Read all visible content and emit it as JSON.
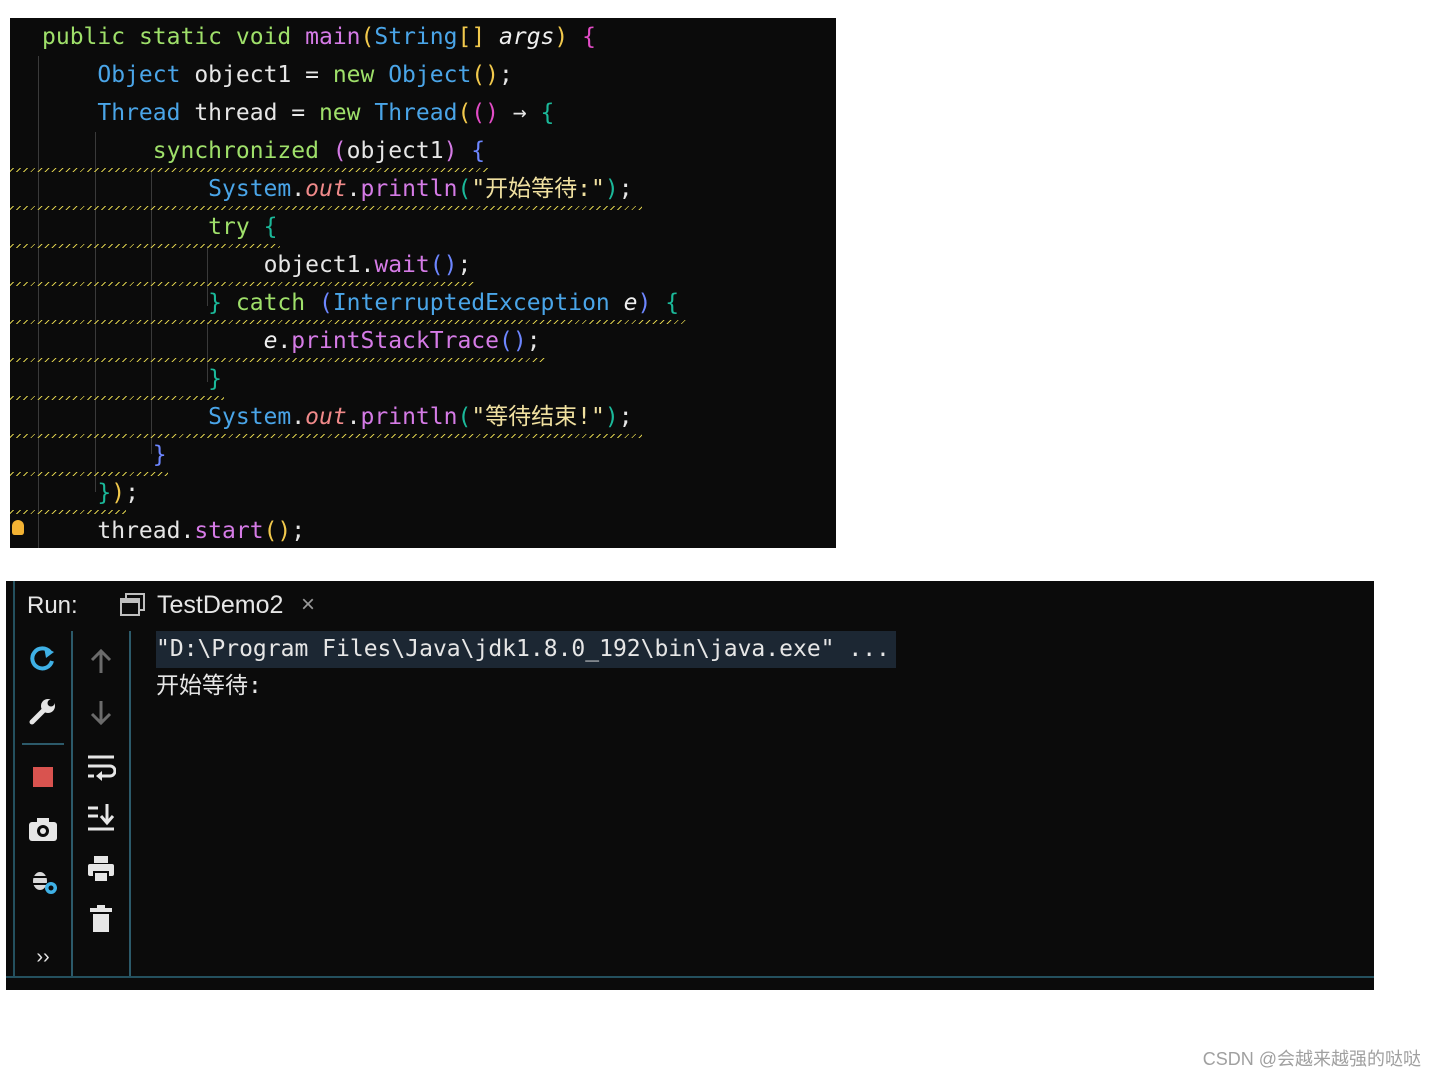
{
  "editor": {
    "lines": [
      {
        "tokens": [
          {
            "t": "public ",
            "c": "kw"
          },
          {
            "t": "static ",
            "c": "kw"
          },
          {
            "t": "void ",
            "c": "kw"
          },
          {
            "t": "main",
            "c": "fn"
          },
          {
            "t": "(",
            "c": "brk"
          },
          {
            "t": "String",
            "c": "type"
          },
          {
            "t": "[] ",
            "c": "brk"
          },
          {
            "t": "args",
            "c": "param"
          },
          {
            "t": ") ",
            "c": "brk"
          },
          {
            "t": "{",
            "c": "pink"
          }
        ]
      },
      {
        "tokens": [
          {
            "t": "    "
          },
          {
            "t": "Object ",
            "c": "type"
          },
          {
            "t": "object1 = "
          },
          {
            "t": "new ",
            "c": "kw"
          },
          {
            "t": "Object",
            "c": "type"
          },
          {
            "t": "()",
            "c": "brk"
          },
          {
            "t": ";"
          }
        ]
      },
      {
        "tokens": [
          {
            "t": "    "
          },
          {
            "t": "Thread ",
            "c": "type"
          },
          {
            "t": "thread = "
          },
          {
            "t": "new ",
            "c": "kw"
          },
          {
            "t": "Thread",
            "c": "type"
          },
          {
            "t": "(",
            "c": "brk"
          },
          {
            "t": "()",
            "c": "pink"
          },
          {
            "t": " → "
          },
          {
            "t": "{",
            "c": "teal"
          }
        ]
      },
      {
        "tokens": [
          {
            "t": "        "
          },
          {
            "t": "synchronized ",
            "c": "kw"
          },
          {
            "t": "(",
            "c": "fn"
          },
          {
            "t": "object1"
          },
          {
            "t": ") ",
            "c": "fn"
          },
          {
            "t": "{",
            "c": "blue"
          }
        ]
      },
      {
        "tokens": [
          {
            "t": "            "
          },
          {
            "t": "System",
            "c": "type"
          },
          {
            "t": "."
          },
          {
            "t": "out",
            "c": "field"
          },
          {
            "t": "."
          },
          {
            "t": "println",
            "c": "fn"
          },
          {
            "t": "(",
            "c": "teal"
          },
          {
            "t": "\"开始等待:\"",
            "c": "str"
          },
          {
            "t": ")",
            "c": "teal"
          },
          {
            "t": ";"
          }
        ]
      },
      {
        "tokens": [
          {
            "t": "            "
          },
          {
            "t": "try ",
            "c": "kw"
          },
          {
            "t": "{",
            "c": "teal"
          }
        ]
      },
      {
        "tokens": [
          {
            "t": "                "
          },
          {
            "t": "object1"
          },
          {
            "t": "."
          },
          {
            "t": "wait",
            "c": "fn"
          },
          {
            "t": "()",
            "c": "blue"
          },
          {
            "t": ";"
          }
        ]
      },
      {
        "tokens": [
          {
            "t": "            "
          },
          {
            "t": "} ",
            "c": "teal"
          },
          {
            "t": "catch ",
            "c": "kw"
          },
          {
            "t": "(",
            "c": "blue"
          },
          {
            "t": "InterruptedException ",
            "c": "type"
          },
          {
            "t": "e",
            "c": "param"
          },
          {
            "t": ") ",
            "c": "blue"
          },
          {
            "t": "{",
            "c": "teal"
          }
        ]
      },
      {
        "tokens": [
          {
            "t": "                "
          },
          {
            "t": "e",
            "c": "param"
          },
          {
            "t": "."
          },
          {
            "t": "printStackTrace",
            "c": "fn"
          },
          {
            "t": "()",
            "c": "blue"
          },
          {
            "t": ";"
          }
        ]
      },
      {
        "tokens": [
          {
            "t": "            "
          },
          {
            "t": "}",
            "c": "teal"
          }
        ]
      },
      {
        "tokens": [
          {
            "t": "            "
          },
          {
            "t": "System",
            "c": "type"
          },
          {
            "t": "."
          },
          {
            "t": "out",
            "c": "field"
          },
          {
            "t": "."
          },
          {
            "t": "println",
            "c": "fn"
          },
          {
            "t": "(",
            "c": "teal"
          },
          {
            "t": "\"等待结束!\"",
            "c": "str"
          },
          {
            "t": ")",
            "c": "teal"
          },
          {
            "t": ";"
          }
        ]
      },
      {
        "tokens": [
          {
            "t": "        "
          },
          {
            "t": "}",
            "c": "blue"
          }
        ]
      },
      {
        "tokens": [
          {
            "t": "    "
          },
          {
            "t": "}",
            "c": "teal"
          },
          {
            "t": ")",
            "c": "brk"
          },
          {
            "t": ";"
          }
        ]
      },
      {
        "tokens": [
          {
            "t": "    "
          },
          {
            "t": "thread."
          },
          {
            "t": "start",
            "c": "fn"
          },
          {
            "t": "()",
            "c": "brk"
          },
          {
            "t": ";"
          }
        ]
      }
    ]
  },
  "run_panel": {
    "label": "Run:",
    "tab_title": "TestDemo2",
    "tab_close": "×",
    "left_tools": [
      "rerun-icon",
      "wrench-icon",
      "stop-icon",
      "camera-icon",
      "debug-gear-icon"
    ],
    "more": "››",
    "right_tools": [
      "arrow-up-icon",
      "arrow-down-icon",
      "soft-wrap-icon",
      "scroll-to-end-icon",
      "print-icon",
      "trash-icon"
    ],
    "console": {
      "command": "\"D:\\Program Files\\Java\\jdk1.8.0_192\\bin\\java.exe\" ...",
      "output": [
        "开始等待:"
      ]
    }
  },
  "watermark": "CSDN @会越来越强的哒哒"
}
